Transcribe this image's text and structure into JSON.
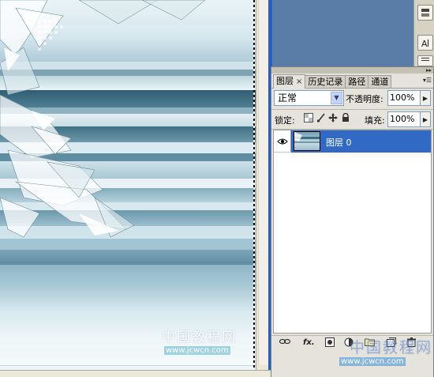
{
  "layers_panel": {
    "tabs": [
      {
        "label": "图层",
        "close": "×"
      },
      {
        "label": "历史记录"
      },
      {
        "label": "路径"
      },
      {
        "label": "通道"
      }
    ],
    "blend_mode": "正常",
    "opacity_label": "不透明度:",
    "opacity_value": "100%",
    "lock_label": "锁定:",
    "fill_label": "填充:",
    "fill_value": "100%",
    "layers": [
      {
        "name": "图层 0",
        "visible": true,
        "selected": true
      }
    ]
  },
  "dock": {
    "buttons": [
      "brush-preset-icon",
      "character-icon",
      "paragraph-icon"
    ]
  },
  "watermarks": {
    "canvas_title": "中国教程网",
    "canvas_url": "www.jcwcn.com",
    "panel_title": "中国教程网",
    "panel_url": "www.jcwcn.com"
  },
  "colors": {
    "selection": "#316ac5",
    "panel_bg": "#e5e3dc",
    "xp_frame": "#ece9d8"
  }
}
